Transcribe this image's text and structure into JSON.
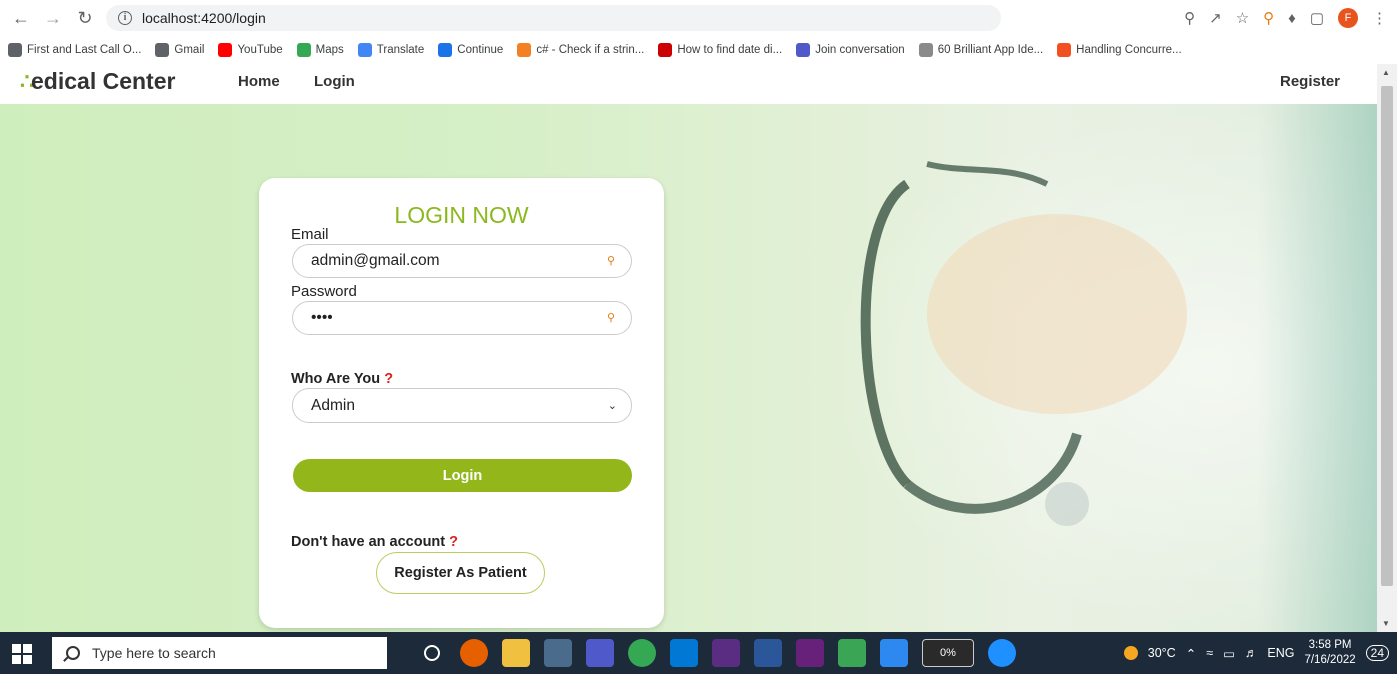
{
  "browser": {
    "url": "localhost:4200/login",
    "profile_initial": "F",
    "bookmarks": [
      {
        "label": "First and Last Call O...",
        "icon": "globe-icon",
        "color": "#5f6368"
      },
      {
        "label": "Gmail",
        "icon": "globe-icon",
        "color": "#5f6368"
      },
      {
        "label": "YouTube",
        "icon": "youtube-icon",
        "color": "#ff0000"
      },
      {
        "label": "Maps",
        "icon": "maps-icon",
        "color": "#34a853"
      },
      {
        "label": "Translate",
        "icon": "translate-icon",
        "color": "#4285f4"
      },
      {
        "label": "Continue",
        "icon": "continue-icon",
        "color": "#1a73e8"
      },
      {
        "label": "c# - Check if a strin...",
        "icon": "stackoverflow-icon",
        "color": "#f48024"
      },
      {
        "label": "How to find date di...",
        "icon": "n-icon",
        "color": "#cc0000"
      },
      {
        "label": "Join conversation",
        "icon": "teams-icon",
        "color": "#5059c9"
      },
      {
        "label": "60 Brilliant App Ide...",
        "icon": "globe-icon",
        "color": "#8a8a8a"
      },
      {
        "label": "Handling Concurre...",
        "icon": "microsoft-icon",
        "color": "#f25022"
      }
    ]
  },
  "navbar": {
    "brand_logo": "∴",
    "brand_text": "edical Center",
    "home": "Home",
    "login": "Login",
    "register": "Register"
  },
  "login_card": {
    "title": "LOGIN NOW",
    "email_label": "Email",
    "email_value": "admin@gmail.com",
    "password_label": "Password",
    "password_value": "••••",
    "who_label": "Who Are You",
    "question_mark": "?",
    "role_selected": "Admin",
    "login_button": "Login",
    "no_account_text": "Don't have an account",
    "register_button": "Register As Patient"
  },
  "taskbar": {
    "search_placeholder": "Type here to search",
    "battery_percent": "0%",
    "temperature": "30°C",
    "language": "ENG",
    "time": "3:58 PM",
    "date": "7/16/2022",
    "notifications": "24"
  },
  "colors": {
    "accent": "#8cb81f",
    "button": "#93b71a",
    "required": "#e02020"
  }
}
